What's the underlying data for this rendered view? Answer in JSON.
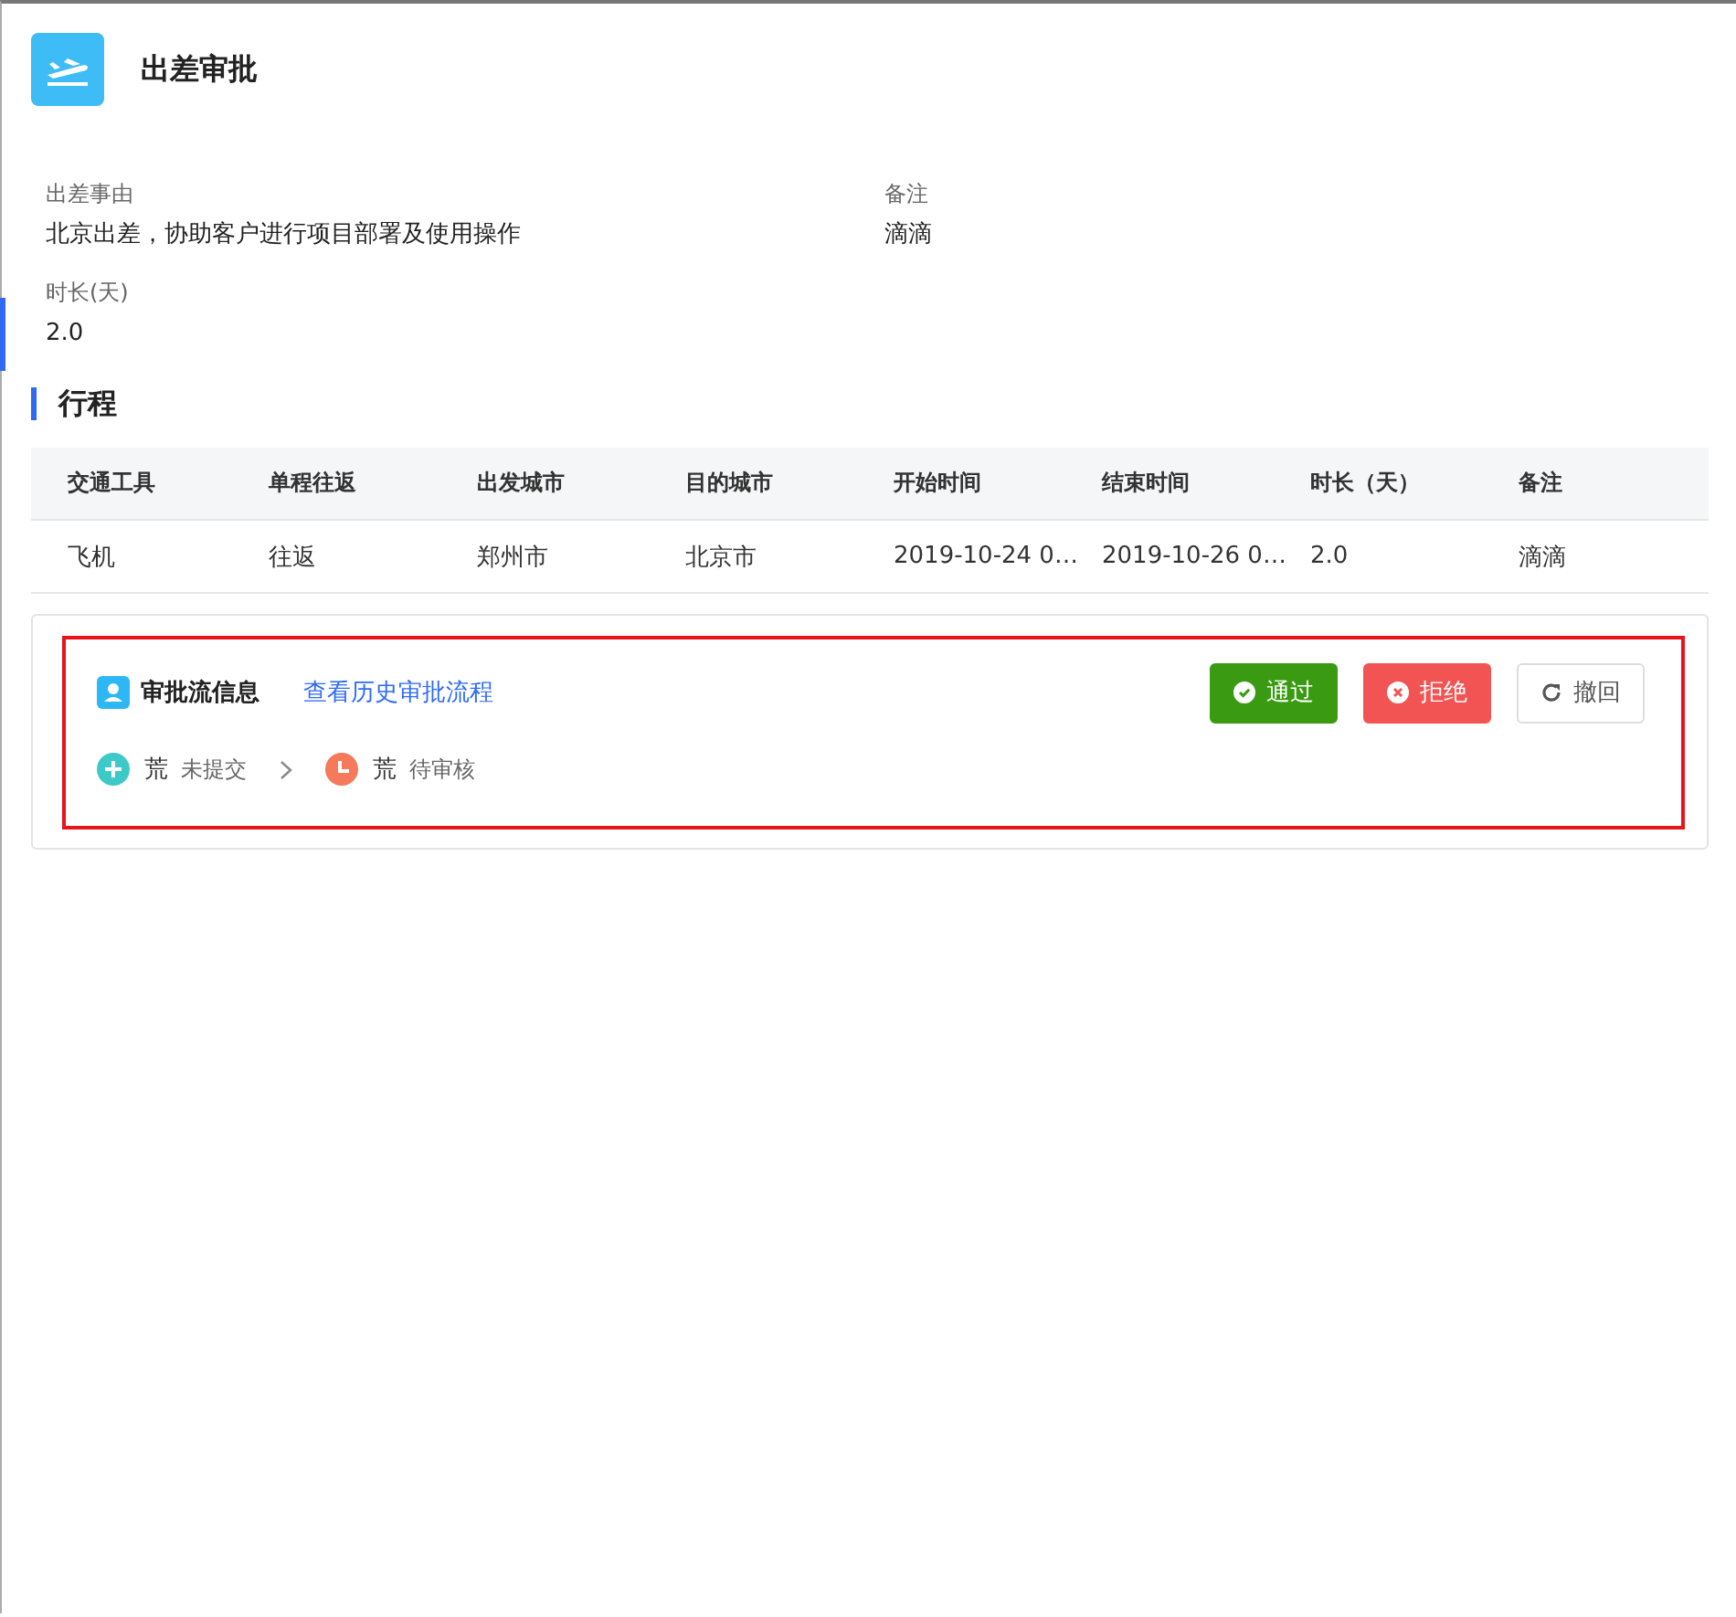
{
  "header": {
    "title": "出差审批"
  },
  "fields": [
    {
      "label": "出差事由",
      "value": "北京出差，协助客户进行项目部署及使用操作"
    },
    {
      "label": "备注",
      "value": "滴滴"
    },
    {
      "label": "时长(天)",
      "value": "2.0"
    }
  ],
  "itinerary": {
    "title": "行程",
    "columns": [
      "交通工具",
      "单程往返",
      "出发城市",
      "目的城市",
      "开始时间",
      "结束时间",
      "时长（天）",
      "备注"
    ],
    "rows": [
      [
        "飞机",
        "往返",
        "郑州市",
        "北京市",
        "2019-10-24 0…",
        "2019-10-26 0…",
        "2.0",
        "滴滴"
      ]
    ]
  },
  "approval": {
    "title": "审批流信息",
    "history_link": "查看历史审批流程",
    "buttons": [
      {
        "kind": "approve",
        "label": "通过"
      },
      {
        "kind": "reject",
        "label": "拒绝"
      },
      {
        "kind": "withdraw",
        "label": "撤回"
      }
    ],
    "steps": [
      {
        "kind": "submit",
        "color": "#3ec9c9",
        "name": "荒",
        "status": "未提交"
      },
      {
        "kind": "pending",
        "color": "#f5795b",
        "name": "荒",
        "status": "待审核"
      }
    ]
  }
}
